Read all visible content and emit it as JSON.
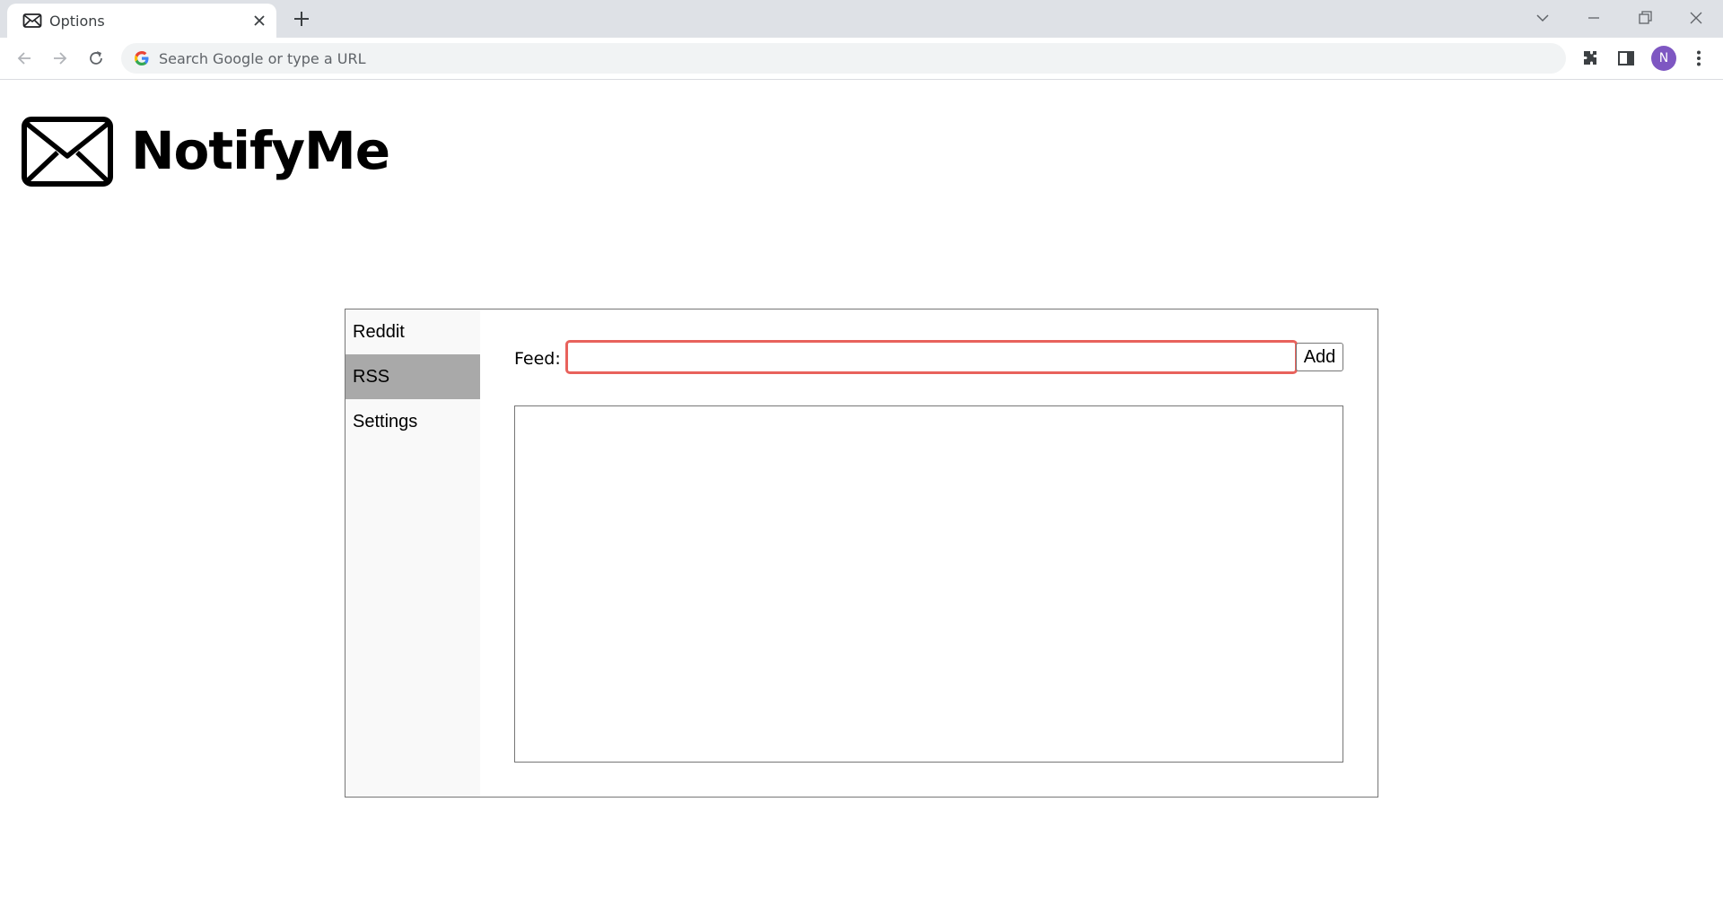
{
  "browser": {
    "tab": {
      "title": "Options",
      "icon": "envelope-icon"
    },
    "omnibox": {
      "placeholder": "Search Google or type a URL",
      "value": ""
    },
    "profile_initial": "N",
    "accent_color": "#7e57c2"
  },
  "app": {
    "name": "NotifyMe",
    "logo_icon": "envelope-icon"
  },
  "sidebar": {
    "items": [
      {
        "label": "Reddit",
        "active": false
      },
      {
        "label": "RSS",
        "active": true
      },
      {
        "label": "Settings",
        "active": false
      }
    ],
    "active_color": "#a9a9a9"
  },
  "rss": {
    "feed_label": "Feed:",
    "feed_value": "",
    "add_label": "Add",
    "focus_color": "#e8625c",
    "feeds": []
  }
}
